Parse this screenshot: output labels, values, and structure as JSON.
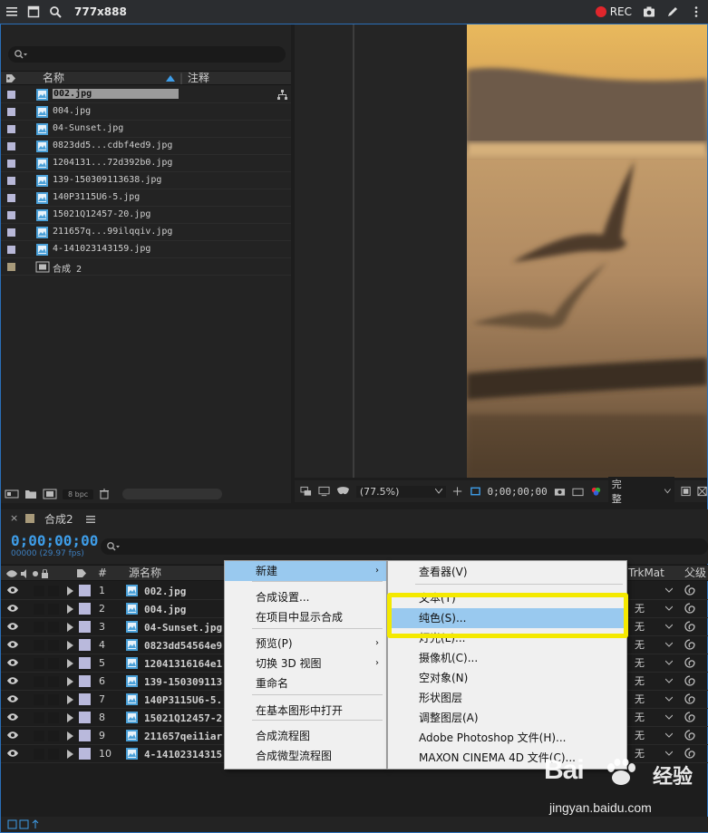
{
  "window": {
    "title": "777x888",
    "rec_label": "REC"
  },
  "project": {
    "columns": {
      "name": "名称",
      "comment": "注释"
    },
    "items": [
      {
        "name": "002.jpg",
        "type": "image",
        "selected": true
      },
      {
        "name": "004.jpg",
        "type": "image"
      },
      {
        "name": "04-Sunset.jpg",
        "type": "image"
      },
      {
        "name": "0823dd5...cdbf4ed9.jpg",
        "type": "image"
      },
      {
        "name": "1204131...72d392b0.jpg",
        "type": "image"
      },
      {
        "name": "139-150309113638.jpg",
        "type": "image"
      },
      {
        "name": "140P3115U6-5.jpg",
        "type": "image"
      },
      {
        "name": "15021Q12457-20.jpg",
        "type": "image"
      },
      {
        "name": "211657q...99ilqqiv.jpg",
        "type": "image"
      },
      {
        "name": "4-141023143159.jpg",
        "type": "image"
      },
      {
        "name": "合成 2",
        "type": "comp"
      }
    ],
    "bpc": "8 bpc"
  },
  "viewer": {
    "zoom": "(77.5%)",
    "timecode": "0;00;00;00",
    "quality": "完整"
  },
  "timeline": {
    "tab": "合成2",
    "timecode": "0;00;00;00",
    "fps": "00000 (29.97 fps)",
    "columns": {
      "hash": "#",
      "source": "源名称",
      "trkmat": "TrkMat",
      "parent": "父级"
    },
    "layers": [
      {
        "num": "1",
        "name": "002.jpg",
        "trk": ""
      },
      {
        "num": "2",
        "name": "004.jpg",
        "trk": "无"
      },
      {
        "num": "3",
        "name": "04-Sunset.jpg",
        "trk": "无"
      },
      {
        "num": "4",
        "name": "0823dd54564e9",
        "trk": "无"
      },
      {
        "num": "5",
        "name": "12041316164e1",
        "trk": "无"
      },
      {
        "num": "6",
        "name": "139-150309113",
        "trk": "无"
      },
      {
        "num": "7",
        "name": "140P3115U6-5.",
        "trk": "无"
      },
      {
        "num": "8",
        "name": "15021Q12457-2",
        "trk": "无"
      },
      {
        "num": "9",
        "name": "211657qei1iar",
        "trk": "无"
      },
      {
        "num": "10",
        "name": "4-14102314315",
        "trk": "无"
      }
    ]
  },
  "context_menu": {
    "items": [
      "新建",
      "合成设置...",
      "在项目中显示合成",
      "预览(P)",
      "切换 3D 视图",
      "重命名",
      "在基本图形中打开",
      "合成流程图",
      "合成微型流程图"
    ]
  },
  "submenu": {
    "items": [
      "查看器(V)",
      "文本(T)",
      "纯色(S)...",
      "灯光(L)...",
      "摄像机(C)...",
      "空对象(N)",
      "形状图层",
      "调整图层(A)",
      "Adobe Photoshop 文件(H)...",
      "MAXON CINEMA 4D 文件(C)..."
    ]
  },
  "watermark": {
    "brand": "Bai",
    "suffix": "经验",
    "url": "jingyan.baidu.com"
  }
}
